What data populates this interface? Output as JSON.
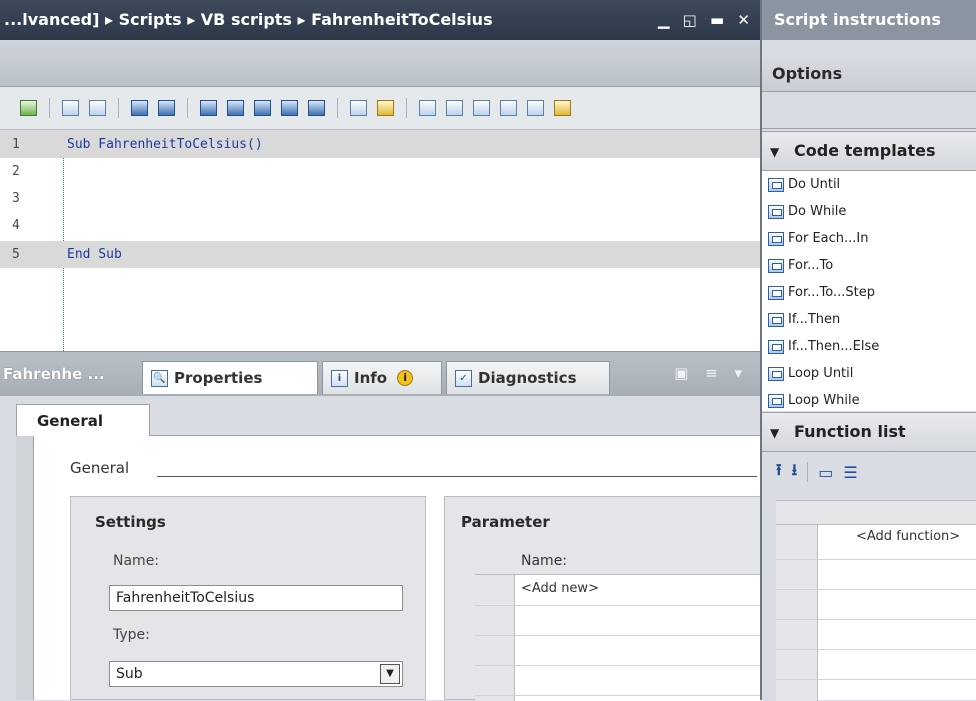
{
  "window": {
    "breadcrumb": "...lvanced] ▸ Scripts ▸ VB scripts ▸ FahrenheitToCelsius",
    "controls": "▁ ◱ ▬ ✕"
  },
  "editor": {
    "lines": [
      {
        "num": "1",
        "code": "Sub FahrenheitToCelsius()"
      },
      {
        "num": "2",
        "code": ""
      },
      {
        "num": "3",
        "code": ""
      },
      {
        "num": "4",
        "code": ""
      },
      {
        "num": "5",
        "code": "End Sub"
      }
    ]
  },
  "bottom_tabs": {
    "title": "Fahrenhe ...",
    "properties": "Properties",
    "info": "Info",
    "diagnostics": "Diagnostics",
    "icons": "▣ ≡ ▾"
  },
  "properties": {
    "tab_general": "General",
    "section_label": "General",
    "settings": {
      "title": "Settings",
      "name_label": "Name:",
      "name_value": "FahrenheitToCelsius",
      "type_label": "Type:",
      "type_value": "Sub"
    },
    "parameter": {
      "title": "Parameter",
      "col_name": "Name:",
      "add_new": "<Add new>"
    }
  },
  "right_pane": {
    "title": "Script instructions",
    "options": "Options",
    "code_templates": {
      "header": "Code templates",
      "items": [
        "Do Until",
        "Do While",
        "For Each...In",
        "For...To",
        "For...To...Step",
        "If...Then",
        "If...Then...Else",
        "Loop Until",
        "Loop While"
      ]
    },
    "function_list": {
      "header": "Function list",
      "add_function": "<Add function>"
    }
  }
}
